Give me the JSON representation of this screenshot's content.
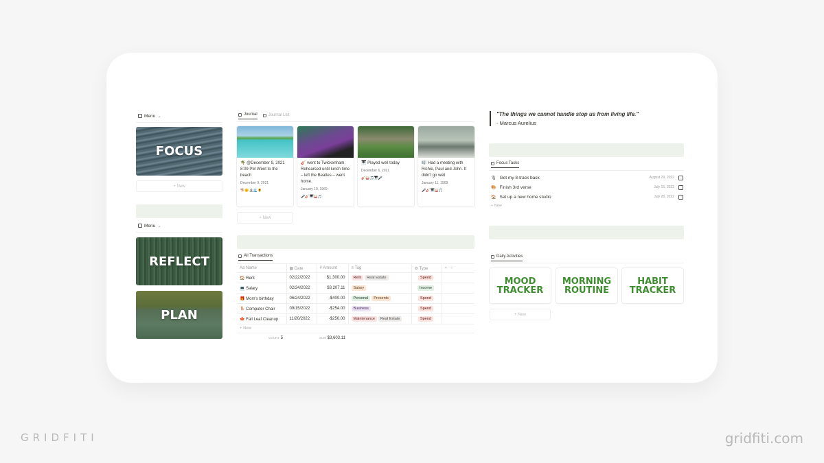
{
  "branding": {
    "left": "GRIDFITI",
    "right": "gridfiti.com"
  },
  "left_column": {
    "menu1": {
      "label": "Menu",
      "icon": "gallery-icon"
    },
    "tiles1": [
      {
        "label": "FOCUS",
        "name": "focus"
      }
    ],
    "new_label": "New",
    "menu2": {
      "label": "Menu",
      "icon": "gallery-icon"
    },
    "tiles2": [
      {
        "label": "REFLECT",
        "name": "reflect"
      },
      {
        "label": "PLAN",
        "name": "plan"
      }
    ]
  },
  "journal": {
    "tabs": [
      {
        "label": "Journal",
        "active": true
      },
      {
        "label": "Journal List",
        "active": false
      }
    ],
    "cards": [
      {
        "icon": "🌴",
        "text": "@December 9, 2021 8:09 PM Went to the beach",
        "date": "December 9, 2021",
        "emojis": "🐕🌞🏝🌊🌻"
      },
      {
        "icon": "🎸",
        "text": "went to Twickenham. Rehearsed until lunch time – left the Beatles – went home.",
        "date": "January 10, 1969",
        "emojis": "🎤🎸🎹🥁🎵"
      },
      {
        "icon": "🎹",
        "text": "Played well today",
        "date": "December 6, 2021",
        "emojis": "🎸🥁🎵🎹🎤"
      },
      {
        "icon": "🎼",
        "text": "Had a meeting with Richie, Paul and John. It didn't go well",
        "date": "January 11, 1969",
        "emojis": "🎤🎸🎹🥁🎵"
      }
    ],
    "new_label": "New"
  },
  "transactions": {
    "tab_label": "All Transactions",
    "columns": [
      "Name",
      "Date",
      "Amount",
      "Tag",
      "Type"
    ],
    "rows": [
      {
        "icon": "🏠",
        "name": "Rent",
        "date": "02/22/2022",
        "amount": "$1,300.00",
        "tags": [
          {
            "label": "Rent",
            "color": "red"
          },
          {
            "label": "Real Estate",
            "color": "gray"
          }
        ],
        "type": "Spend"
      },
      {
        "icon": "💻",
        "name": "Salary",
        "date": "02/24/2022",
        "amount": "$3,207.11",
        "tags": [
          {
            "label": "Salary",
            "color": "orange"
          }
        ],
        "type": "Income"
      },
      {
        "icon": "🎁",
        "name": "Mom's birthday",
        "date": "06/24/2022",
        "amount": "-$400.00",
        "tags": [
          {
            "label": "Personal",
            "color": "green"
          },
          {
            "label": "Presents",
            "color": "orange"
          }
        ],
        "type": "Spend"
      },
      {
        "icon": "🪑",
        "name": "Computer Chair",
        "date": "09/15/2022",
        "amount": "-$254.00",
        "tags": [
          {
            "label": "Business",
            "color": "purple"
          }
        ],
        "type": "Spend"
      },
      {
        "icon": "🍁",
        "name": "Fall Leaf Cleanup",
        "date": "11/20/2022",
        "amount": "-$250.00",
        "tags": [
          {
            "label": "Maintenance",
            "color": "red"
          },
          {
            "label": "Real Estate",
            "color": "gray"
          }
        ],
        "type": "Spend"
      }
    ],
    "new_label": "New",
    "count_label": "COUNT",
    "count_value": "5",
    "sum_label": "SUM",
    "sum_value": "$3,603.11"
  },
  "quote": {
    "text": "\"The things we cannot handle stop us from living life.\"",
    "author": "- Marcus Aurelius"
  },
  "focus_tasks": {
    "tab_label": "Focus Tasks",
    "items": [
      {
        "icon": "🎙",
        "name": "Get my 8-track back",
        "date": "August 29, 2022",
        "checked": false
      },
      {
        "icon": "🎨",
        "name": "Finish 3rd verse",
        "date": "July 15, 2022",
        "checked": false
      },
      {
        "icon": "🏠",
        "name": "Set up a new home studio",
        "date": "July 28, 2022",
        "checked": false
      }
    ],
    "new_label": "New"
  },
  "daily_activities": {
    "tab_label": "Daily Activities",
    "items": [
      {
        "line1": "MOOD",
        "line2": "TRACKER"
      },
      {
        "line1": "MORNING",
        "line2": "ROUTINE"
      },
      {
        "line1": "HABIT",
        "line2": "TRACKER"
      }
    ],
    "new_label": "New"
  }
}
